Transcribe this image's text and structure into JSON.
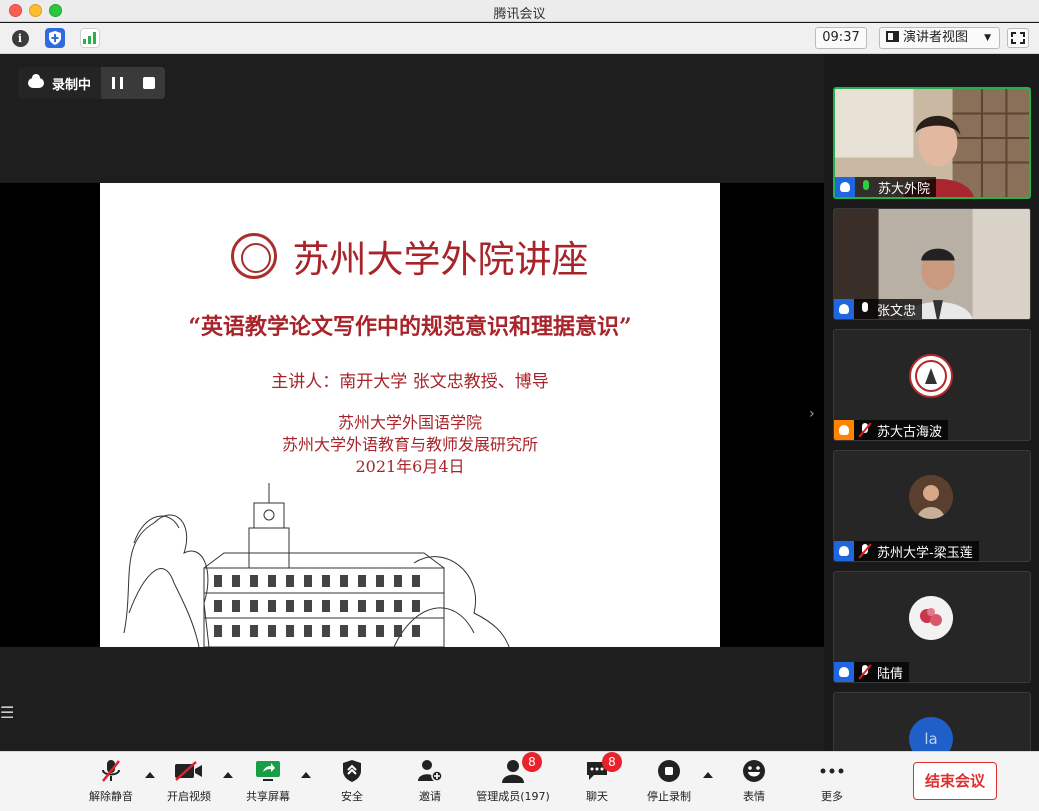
{
  "window": {
    "title": "腾讯会议"
  },
  "toolbar": {
    "timer": "09:37",
    "view_mode": "演讲者视图",
    "icons": [
      "info-icon",
      "shield-icon",
      "signal-icon",
      "layout-icon",
      "fullscreen-icon"
    ]
  },
  "recording": {
    "status_label": "录制中"
  },
  "slide": {
    "title": "苏州大学外院讲座",
    "subtitle": "“英语教学论文写作中的规范意识和理据意识”",
    "speaker": "主讲人：南开大学 张文忠教授、博导",
    "org_line1": "苏州大学外国语学院",
    "org_line2": "苏州大学外语教育与教师发展研究所",
    "date": "2021年6月4日"
  },
  "participants": [
    {
      "name": "苏大外院",
      "mic": "on",
      "role_color": "#1f66e0",
      "video": true
    },
    {
      "name": "张文忠",
      "mic": "idle",
      "role_color": "#1f66e0",
      "video": true
    },
    {
      "name": "苏大古海波",
      "mic": "muted",
      "role_color": "#ff8200",
      "video": false
    },
    {
      "name": "苏州大学-梁玉莲",
      "mic": "muted",
      "role_color": "#1f66e0",
      "video": false
    },
    {
      "name": "陆倩",
      "mic": "muted",
      "role_color": "#1f66e0",
      "video": false
    },
    {
      "name": "",
      "mic": "",
      "role_color": "#1f66e0",
      "video": false,
      "initials": "la"
    }
  ],
  "controls": {
    "unmute": "解除静音",
    "start_video": "开启视频",
    "share_screen": "共享屏幕",
    "security": "安全",
    "invite": "邀请",
    "manage_members": "管理成员(197)",
    "manage_badge": "8",
    "chat": "聊天",
    "chat_badge": "8",
    "stop_recording": "停止录制",
    "reactions": "表情",
    "more": "更多",
    "end_meeting": "结束会议"
  },
  "colors": {
    "accent_green": "#22b14c",
    "end_red": "#e02f2f",
    "slide_red": "#a8242a",
    "badge_red": "#e8222b"
  }
}
